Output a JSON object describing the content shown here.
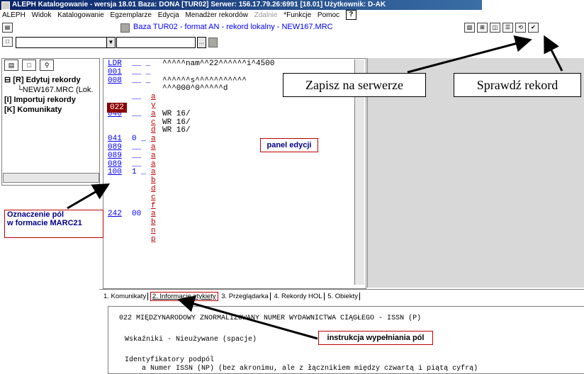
{
  "window": {
    "title": "ALEPH Katalogowanie - wersja 18.01  Baza:  DONA [TUR02]  Serwer:  156.17.79.26:6991 [18.01]  Użytkownik:  D-AK"
  },
  "menu": {
    "items": [
      "ALEPH",
      "Widok",
      "Katalogowanie",
      "Egzemplarze",
      "Edycja",
      "Menadżer rekordów",
      "Zdalnie",
      "*Funkcje",
      "Pomoc"
    ],
    "help_label": "?"
  },
  "record": {
    "title": "Baza TUR02 - format AN - rekord lokalny - NEW167.MRC"
  },
  "tree": {
    "items": [
      "[R] Edytuj rekordy",
      "NEW167.MRC (Lok.",
      "[I] Importuj rekordy",
      "[K] Komunikaty"
    ]
  },
  "editor": {
    "rows": [
      {
        "tag": "LDR",
        "ind": "__ _",
        "sub": "",
        "value": "^^^^^nam^^22^^^^^^i^4500"
      },
      {
        "tag": "001",
        "ind": "__ _",
        "sub": "",
        "value": ""
      },
      {
        "tag": "008",
        "ind": "__ _",
        "sub": "",
        "value": "^^^^^^s^^^^^^^^^^^"
      },
      {
        "tag": "",
        "ind": "",
        "sub": "",
        "value": "^^^000^0^^^^^d"
      },
      {
        "tag": "022",
        "ind": "__",
        "sub": "a",
        "value": ""
      },
      {
        "tag": "",
        "ind": "",
        "sub": "y",
        "value": ""
      },
      {
        "tag": "040",
        "ind": "__",
        "sub": "a",
        "value": "WR 16/"
      },
      {
        "tag": "",
        "ind": "",
        "sub": "c",
        "value": "WR 16/"
      },
      {
        "tag": "",
        "ind": "",
        "sub": "d",
        "value": "WR 16/"
      },
      {
        "tag": "041",
        "ind": "0 _",
        "sub": "a",
        "value": ""
      },
      {
        "tag": "089",
        "ind": "__",
        "sub": "a",
        "value": ""
      },
      {
        "tag": "089",
        "ind": "__",
        "sub": "a",
        "value": ""
      },
      {
        "tag": "089",
        "ind": "__",
        "sub": "a",
        "value": ""
      },
      {
        "tag": "100",
        "ind": "1 _",
        "sub": "a",
        "value": ""
      },
      {
        "tag": "",
        "ind": "",
        "sub": "b",
        "value": ""
      },
      {
        "tag": "",
        "ind": "",
        "sub": "d",
        "value": ""
      },
      {
        "tag": "",
        "ind": "",
        "sub": "c",
        "value": ""
      },
      {
        "tag": "",
        "ind": "",
        "sub": "f",
        "value": ""
      },
      {
        "tag": "242",
        "ind": "00",
        "sub": "a",
        "value": ""
      },
      {
        "tag": "",
        "ind": "",
        "sub": "b",
        "value": ""
      },
      {
        "tag": "",
        "ind": "",
        "sub": "n",
        "value": ""
      },
      {
        "tag": "",
        "ind": "",
        "sub": "p",
        "value": ""
      }
    ]
  },
  "bottom_tabs": [
    "1. Komunikaty",
    "2. Informacje etykiety",
    "3. Przeglądarka",
    "4. Rekordy HOL",
    "5. Obiekty"
  ],
  "info": {
    "line1": "022 MIĘDZYNARODOWY ZNORMALIZOWANY NUMER WYDAWNICTWA CIĄGŁEGO - ISSN  (P)",
    "line2": "Wskaźniki - Nieużywane (spacje)",
    "line3": "Identyfikatory podpól",
    "line4": "a   Numer ISSN  (NP) (bez akronimu, ale z łącznikiem między czwartą i piątą cyfrą)"
  },
  "annotations": {
    "save": "Zapisz na serwerze",
    "check": "Sprawdź rekord",
    "edit_panel": "panel edycji",
    "fields_marc": "Oznaczenie pól\nw formacie MARC21",
    "fields_line1": "Oznaczenie pól",
    "fields_line2": "w formacie MARC21",
    "instruction": "instrukcja wypełniania pól"
  },
  "colors": {
    "title_bg": "#0a246a",
    "selected_tag": "#8b0000",
    "link": "#0000ff",
    "subfield": "#c00000"
  }
}
